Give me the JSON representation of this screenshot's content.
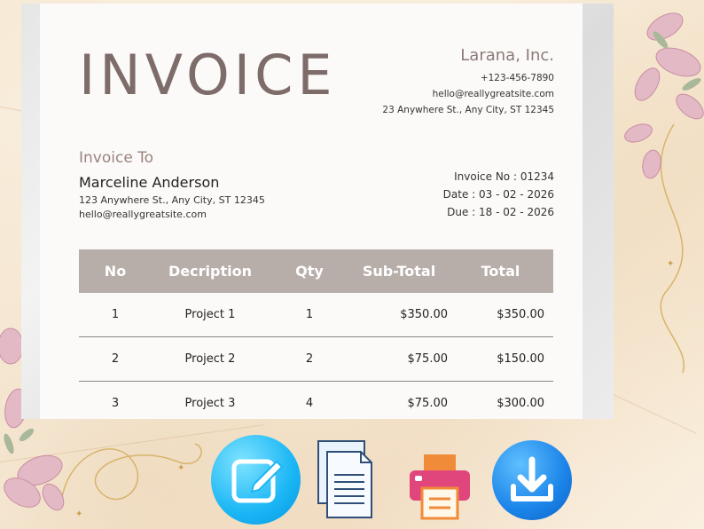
{
  "invoice": {
    "title": "INVOICE",
    "company": {
      "name": "Larana, Inc.",
      "phone": "+123-456-7890",
      "email": "hello@reallygreatsite.com",
      "address": "23 Anywhere St., Any City, ST 12345"
    },
    "bill_to": {
      "label": "Invoice To",
      "name": "Marceline Anderson",
      "address": "123 Anywhere St., Any City, ST 12345",
      "email": "hello@reallygreatsite.com"
    },
    "meta": {
      "number": "Invoice No : 01234",
      "date": "Date : 03 - 02 - 2026",
      "due": "Due : 18 - 02 - 2026"
    },
    "table": {
      "headers": [
        "No",
        "Decription",
        "Qty",
        "Sub-Total",
        "Total"
      ],
      "rows": [
        [
          "1",
          "Project 1",
          "1",
          "$350.00",
          "$350.00"
        ],
        [
          "2",
          "Project 2",
          "2",
          "$75.00",
          "$150.00"
        ],
        [
          "3",
          "Project 3",
          "4",
          "$75.00",
          "$300.00"
        ]
      ]
    }
  },
  "toolbar_icons": [
    "edit-icon",
    "document-icon",
    "printer-icon",
    "download-icon"
  ],
  "colors": {
    "title": "#7d6c6a",
    "table_header": "#b7aeaa",
    "edit_button": "#1ab6f5",
    "download_button": "#1b84e8",
    "printer": "#e0457b"
  }
}
